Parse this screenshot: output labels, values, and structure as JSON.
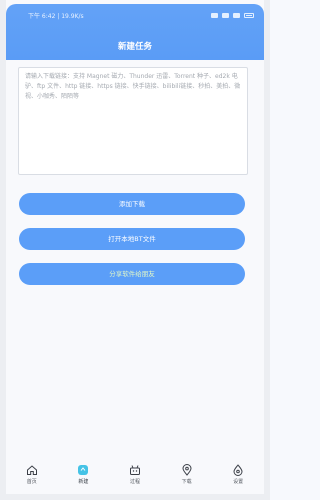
{
  "status_bar": {
    "time_text": "下午 6:42 | 19.9K/s"
  },
  "header": {
    "title": "新建任务"
  },
  "task_input": {
    "value": "",
    "placeholder": "请输入下载链接：支持 Magnet 磁力、Thunder 迅雷、Torrent 种子、ed2k 电驴、ftp 文件、http 链接、https 链接、快手链接、bilibili链接、秒拍、美拍、微视、小咖秀、陌陌等"
  },
  "buttons": {
    "add_download": "添加下载",
    "open_local_file": "打开本地BT文件",
    "share_with_friends": "分享软件给朋友"
  },
  "colors": {
    "accent": "#5b9ef8",
    "header": "#5fa0f7",
    "share_text": "#e2f8c8"
  },
  "tabbar": {
    "items": [
      {
        "label": "首页",
        "icon": "home-icon"
      },
      {
        "label": "新建",
        "icon": "new-task-icon"
      },
      {
        "label": "过程",
        "icon": "progress-icon"
      },
      {
        "label": "下载",
        "icon": "download-icon"
      },
      {
        "label": "设置",
        "icon": "settings-icon"
      }
    ],
    "active_index": 1
  }
}
